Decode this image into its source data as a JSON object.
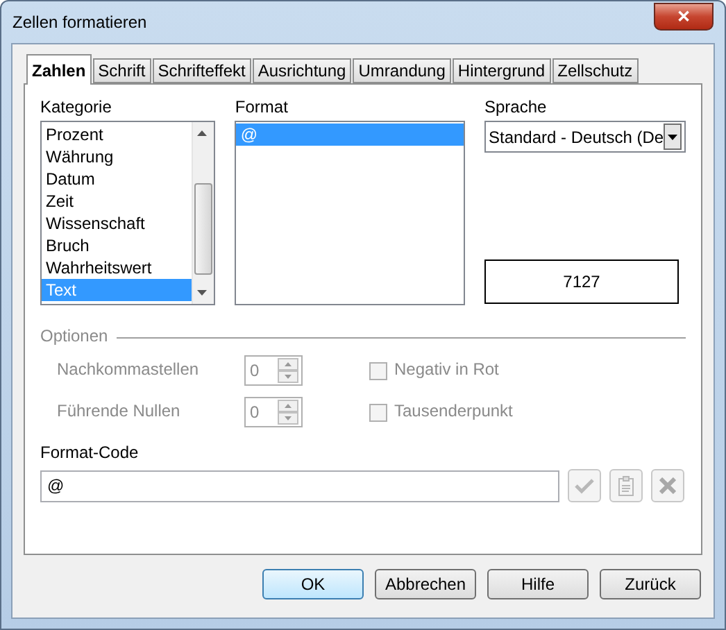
{
  "window": {
    "title": "Zellen formatieren",
    "close": "✕"
  },
  "tabs": [
    {
      "label": "Zahlen",
      "selected": true
    },
    {
      "label": "Schrift",
      "selected": false
    },
    {
      "label": "Schrifteffekt",
      "selected": false
    },
    {
      "label": "Ausrichtung",
      "selected": false
    },
    {
      "label": "Umrandung",
      "selected": false
    },
    {
      "label": "Hintergrund",
      "selected": false
    },
    {
      "label": "Zellschutz",
      "selected": false
    }
  ],
  "category": {
    "label": "Kategorie",
    "items": [
      {
        "label": "Prozent",
        "selected": false
      },
      {
        "label": "Währung",
        "selected": false
      },
      {
        "label": "Datum",
        "selected": false
      },
      {
        "label": "Zeit",
        "selected": false
      },
      {
        "label": "Wissenschaft",
        "selected": false
      },
      {
        "label": "Bruch",
        "selected": false
      },
      {
        "label": "Wahrheitswert",
        "selected": false
      },
      {
        "label": "Text",
        "selected": true
      }
    ]
  },
  "format": {
    "label": "Format",
    "items": [
      {
        "label": "@",
        "selected": true
      }
    ]
  },
  "language": {
    "label": "Sprache",
    "value": "Standard - Deutsch (De"
  },
  "preview": "7127",
  "options": {
    "title": "Optionen",
    "disabled": true,
    "spinners": [
      {
        "label": "Nachkommastellen",
        "value": "0"
      },
      {
        "label": "Führende Nullen",
        "value": "0"
      }
    ],
    "checkboxes": [
      {
        "label": "Negativ in Rot",
        "checked": false
      },
      {
        "label": "Tausenderpunkt",
        "checked": false
      }
    ]
  },
  "format_code": {
    "label": "Format-Code",
    "value": "@"
  },
  "buttons": [
    {
      "label": "OK",
      "default": true
    },
    {
      "label": "Abbrechen",
      "default": false
    },
    {
      "label": "Hilfe",
      "default": false
    },
    {
      "label": "Zurück",
      "default": false
    }
  ]
}
